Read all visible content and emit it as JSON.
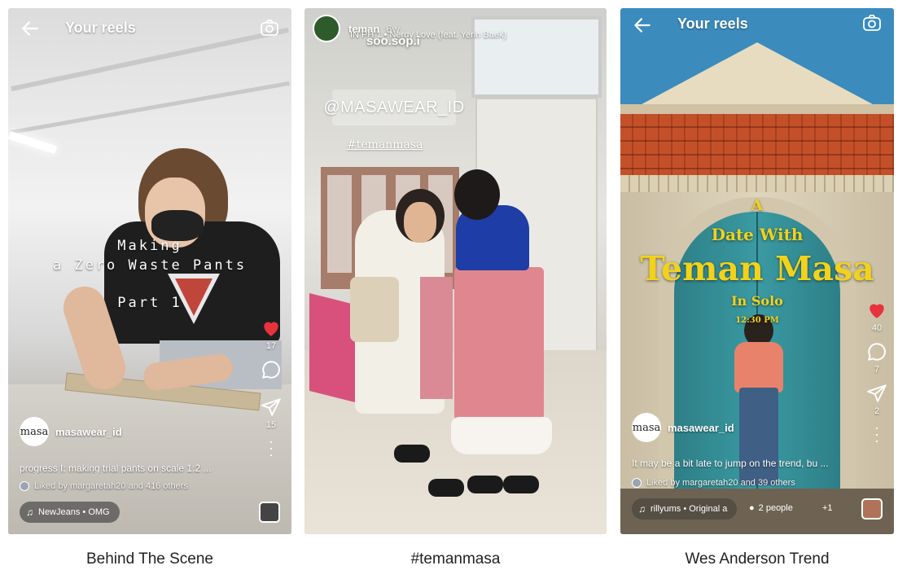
{
  "panels": [
    {
      "topbar_title": "Your reels",
      "overlay_lines": [
        "Making",
        "a Zero Waste Pants",
        "Part 1"
      ],
      "likes": "17",
      "shares": "15",
      "author": "masawear_id",
      "avatar_text": "masa",
      "caption": "progress I: making trial pants on scale 1:2 ...",
      "liked_by": "Liked by margaretah20 and 416 others",
      "audio": "NewJeans • OMG",
      "label": "Behind The Scene"
    },
    {
      "username": "teman",
      "time": "6w",
      "song": "IN PH 1 • Nerdy Love (feat. Yerin Baek)",
      "mention": "soo.sop.i",
      "sticker": "@MASAWEAR_ID",
      "hashtag": "#temanmasa",
      "label": "#temanmasa"
    },
    {
      "topbar_title": "Your reels",
      "title_lines": [
        "A",
        "Date With",
        "Teman Masa",
        "In Solo",
        "12:30 PM"
      ],
      "likes": "40",
      "comments": "7",
      "shares": "2",
      "author": "masawear_id",
      "avatar_text": "masa",
      "caption": "It may be a bit late to jump on the trend, bu ...",
      "liked_by": "Liked by margaretah20 and 39 others",
      "audio": "rillyums • Original a",
      "people": "2 people",
      "extra": "+1",
      "label": "Wes Anderson Trend"
    }
  ],
  "colors": {
    "like_heart": "#e8323c",
    "title_yellow": "#f2d21b",
    "door_teal": "#3a9aa2"
  },
  "icons": [
    "back-arrow-icon",
    "camera-icon",
    "heart-icon",
    "comment-icon",
    "send-icon",
    "more-icon",
    "music-note-icon",
    "person-icon"
  ]
}
